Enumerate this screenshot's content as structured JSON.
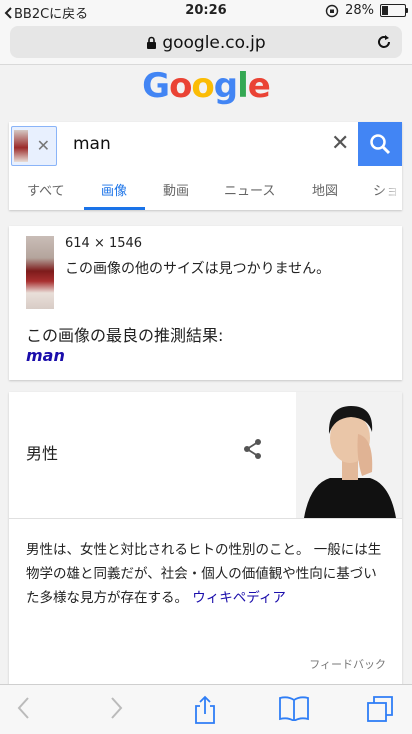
{
  "status_bar": {
    "back_label": "BB2Cに戻る",
    "time": "20:26",
    "battery": "28%",
    "battery_level": 0.28
  },
  "url_bar": {
    "domain": "google.co.jp"
  },
  "logo": {
    "letters": [
      "G",
      "o",
      "o",
      "g",
      "l",
      "e"
    ],
    "colors": [
      "#4285F4",
      "#EA4335",
      "#FBBC05",
      "#4285F4",
      "#34A853",
      "#EA4335"
    ]
  },
  "search": {
    "query": "man",
    "tabs": [
      {
        "label": "すべて",
        "active": false
      },
      {
        "label": "画像",
        "active": true
      },
      {
        "label": "動画",
        "active": false
      },
      {
        "label": "ニュース",
        "active": false
      },
      {
        "label": "地図",
        "active": false
      },
      {
        "label": "ショ",
        "active": false
      }
    ],
    "accent": "#4285f4"
  },
  "result": {
    "dimensions": "614 × 1546",
    "not_found": "この画像の他のサイズは見つかりません。",
    "best_guess_label": "この画像の最良の推測結果:",
    "best_guess_link": "man"
  },
  "knowledge": {
    "title": "男性",
    "description": "男性は、女性と対比されるヒトの性別のこと。 一般には生物学の雄と同義だが、社会・個人の価値観や性向に基づいた多様な見方が存在する。",
    "source_link": "ウィキペディア",
    "feedback": "フィードバック"
  },
  "icons": [
    "back-chevron-icon",
    "lock-icon",
    "reload-icon",
    "search-icon",
    "clear-icon",
    "share-icon",
    "forward-icon",
    "share-sheet-icon",
    "bookmarks-icon",
    "tabs-icon"
  ]
}
